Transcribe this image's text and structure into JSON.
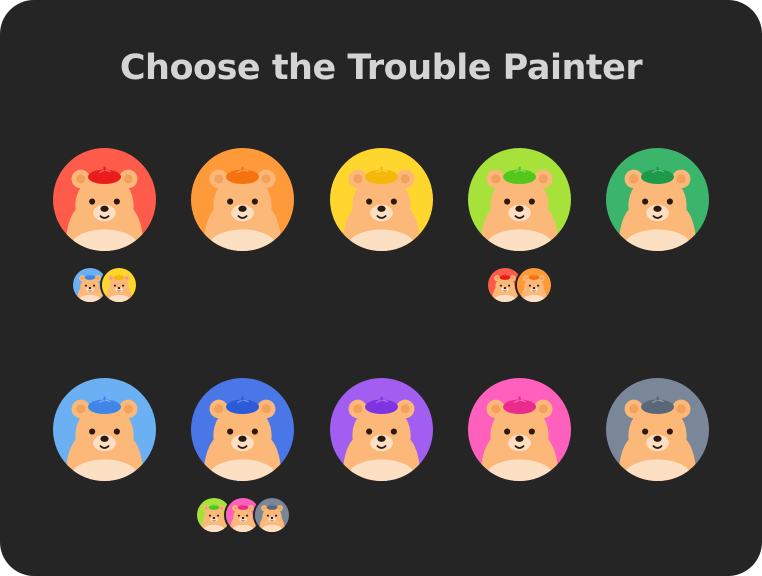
{
  "title": "Choose the Trouble Painter",
  "bear_colors": {
    "fur": "#fcb878",
    "fur_dark": "#f3a25e",
    "muzzle": "#fde0c4",
    "nose": "#2a1a12"
  },
  "painters": [
    {
      "color_name": "red",
      "bg": "#ff5b4a",
      "beret": "#ea1b1b",
      "icon": "bear-red-beret-icon"
    },
    {
      "color_name": "orange",
      "bg": "#ff9a3a",
      "beret": "#f5730f",
      "icon": "bear-orange-beret-icon"
    },
    {
      "color_name": "yellow",
      "bg": "#ffd62e",
      "beret": "#f5b80a",
      "icon": "bear-yellow-beret-icon"
    },
    {
      "color_name": "lime",
      "bg": "#a6e23a",
      "beret": "#53c81c",
      "icon": "bear-lime-beret-icon"
    },
    {
      "color_name": "green",
      "bg": "#3bb46c",
      "beret": "#1d9a4a",
      "icon": "bear-green-beret-icon"
    },
    {
      "color_name": "sky",
      "bg": "#6bb0f2",
      "beret": "#3f86e8",
      "icon": "bear-sky-beret-icon"
    },
    {
      "color_name": "blue",
      "bg": "#4a77e8",
      "beret": "#2d5ad8",
      "icon": "bear-blue-beret-icon"
    },
    {
      "color_name": "purple",
      "bg": "#a25ef0",
      "beret": "#7f34e2",
      "icon": "bear-purple-beret-icon"
    },
    {
      "color_name": "pink",
      "bg": "#ff5fbd",
      "beret": "#ea2c8d",
      "icon": "bear-pink-beret-icon"
    },
    {
      "color_name": "gray",
      "bg": "#7a8799",
      "beret": "#5b6779",
      "icon": "bear-gray-beret-icon"
    }
  ],
  "votes": [
    {
      "painter": 0,
      "voters": [
        5,
        2
      ]
    },
    {
      "painter": 3,
      "voters": [
        0,
        1
      ]
    },
    {
      "painter": 6,
      "voters": [
        3,
        8,
        9
      ]
    }
  ]
}
